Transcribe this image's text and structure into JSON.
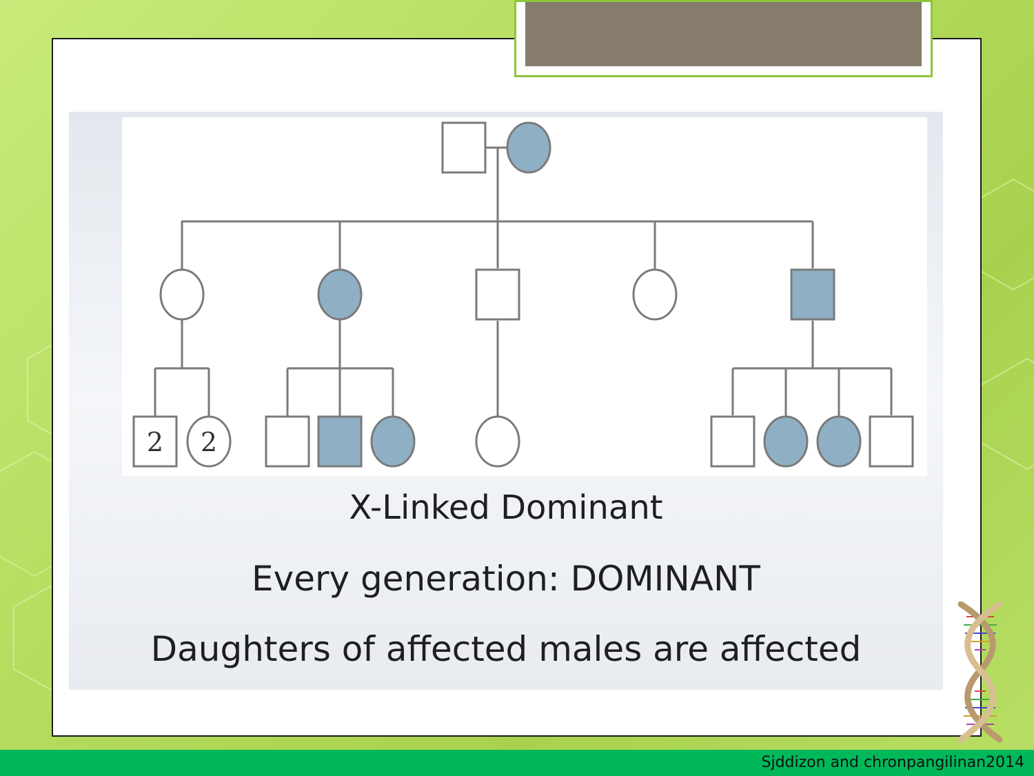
{
  "slide": {
    "title": "",
    "captions": [
      "X-Linked Dominant",
      "Every generation: DOMINANT",
      "Daughters of affected males are affected"
    ],
    "footer_credit": "Sjddizon and chronpangilinan2014"
  },
  "pedigree": {
    "colors": {
      "affected_fill": "#8fb0c4",
      "unaffected_fill": "#ffffff",
      "stroke": "#7a7a7a"
    },
    "generations": [
      {
        "generation": 1,
        "individuals": [
          {
            "id": "I-1",
            "sex": "male",
            "affected": false
          },
          {
            "id": "I-2",
            "sex": "female",
            "affected": true
          }
        ]
      },
      {
        "generation": 2,
        "individuals": [
          {
            "id": "II-1",
            "sex": "female",
            "affected": false
          },
          {
            "id": "II-2",
            "sex": "female",
            "affected": true
          },
          {
            "id": "II-3",
            "sex": "male",
            "affected": false
          },
          {
            "id": "II-4",
            "sex": "female",
            "affected": false
          },
          {
            "id": "II-5",
            "sex": "male",
            "affected": true
          }
        ]
      },
      {
        "generation": 3,
        "individuals": [
          {
            "id": "III-1",
            "sex": "male",
            "affected": false,
            "count": "2",
            "parent": "II-1"
          },
          {
            "id": "III-2",
            "sex": "female",
            "affected": false,
            "count": "2",
            "parent": "II-1"
          },
          {
            "id": "III-3",
            "sex": "male",
            "affected": false,
            "parent": "II-2"
          },
          {
            "id": "III-4",
            "sex": "male",
            "affected": true,
            "parent": "II-2"
          },
          {
            "id": "III-5",
            "sex": "female",
            "affected": true,
            "parent": "II-2"
          },
          {
            "id": "III-6",
            "sex": "female",
            "affected": false,
            "parent": "II-3"
          },
          {
            "id": "III-7",
            "sex": "male",
            "affected": false,
            "parent": "II-5"
          },
          {
            "id": "III-8",
            "sex": "female",
            "affected": true,
            "parent": "II-5"
          },
          {
            "id": "III-9",
            "sex": "female",
            "affected": true,
            "parent": "II-5"
          },
          {
            "id": "III-10",
            "sex": "male",
            "affected": false,
            "parent": "II-5"
          }
        ]
      }
    ]
  }
}
